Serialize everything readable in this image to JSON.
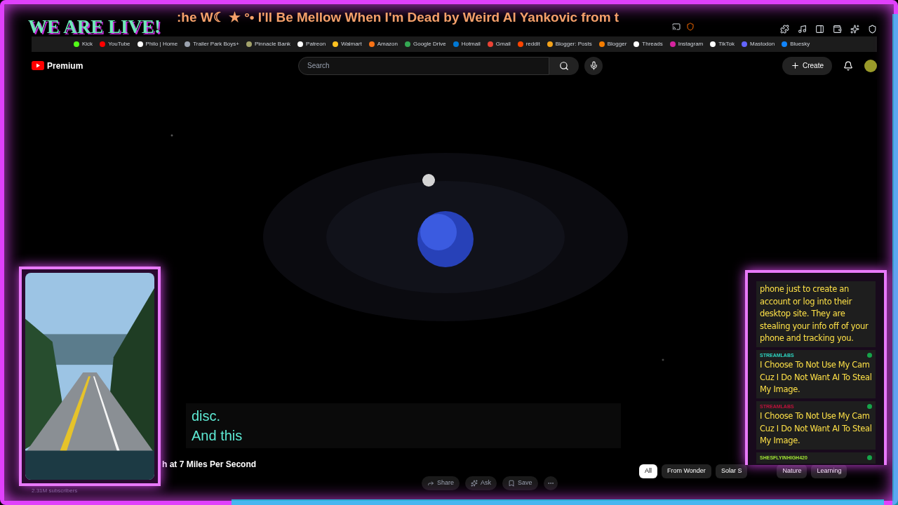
{
  "ticker": ":he W☾ ★ °• I'll Be Mellow When I'm Dead by Weird Al Yankovic from t",
  "overlay_banner": "WE ARE LIVE!",
  "bookmarks": [
    {
      "label": "Kick",
      "color": "#53fc18"
    },
    {
      "label": "YouTube",
      "color": "#ff0000"
    },
    {
      "label": "Philo | Home",
      "color": "#ffffff"
    },
    {
      "label": "Trailer Park Boys+",
      "color": "#9ca3af"
    },
    {
      "label": "Pinnacle Bank",
      "color": "#a3a36b"
    },
    {
      "label": "Patreon",
      "color": "#ffffff"
    },
    {
      "label": "Walmart",
      "color": "#ffc220"
    },
    {
      "label": "Amazon",
      "color": "#f97316"
    },
    {
      "label": "Google Drive",
      "color": "#34a853"
    },
    {
      "label": "Hotmail",
      "color": "#0078d4"
    },
    {
      "label": "Gmail",
      "color": "#ea4335"
    },
    {
      "label": "reddit",
      "color": "#ff4500"
    },
    {
      "label": "Blogger: Posts",
      "color": "#f4a31a"
    },
    {
      "label": "Blogger",
      "color": "#f57d00"
    },
    {
      "label": "Threads",
      "color": "#ffffff"
    },
    {
      "label": "Instagram",
      "color": "#d6249f"
    },
    {
      "label": "TikTok",
      "color": "#ffffff"
    },
    {
      "label": "Mastodon",
      "color": "#6364ff"
    },
    {
      "label": "Bluesky",
      "color": "#1185fe"
    }
  ],
  "header": {
    "logo": "Premium",
    "search": {
      "placeholder": "Search"
    },
    "create": "Create"
  },
  "captions": [
    "disc.",
    "And this"
  ],
  "video_title": "h at 7 Miles Per Second",
  "subscribers": "2.31M subscribers",
  "actions": [
    "Share",
    "Ask",
    "Save"
  ],
  "chips": [
    {
      "label": "All",
      "selected": true
    },
    {
      "label": "From Wonder",
      "selected": false
    },
    {
      "label": "Solar S",
      "selected": false
    },
    {
      "label": "Nature",
      "selected": false
    },
    {
      "label": "Learning",
      "selected": false
    }
  ],
  "chat": [
    {
      "text": "phone just to create an account or log into their desktop site. They are stealing your info off of your phone and tracking you."
    },
    {
      "user": "STREAMLABS",
      "color": "#2dd4bf",
      "text": "I Choose To Not Use My Cam Cuz I Do Not Want AI To Steal My Image."
    },
    {
      "user": "STREAMLABS",
      "color": "#be123c",
      "text": "I Choose To Not Use My Cam Cuz I Do Not Want AI To Steal My Image."
    },
    {
      "user": "SHESFLYINHIGH420",
      "color": "#a3e635"
    }
  ]
}
